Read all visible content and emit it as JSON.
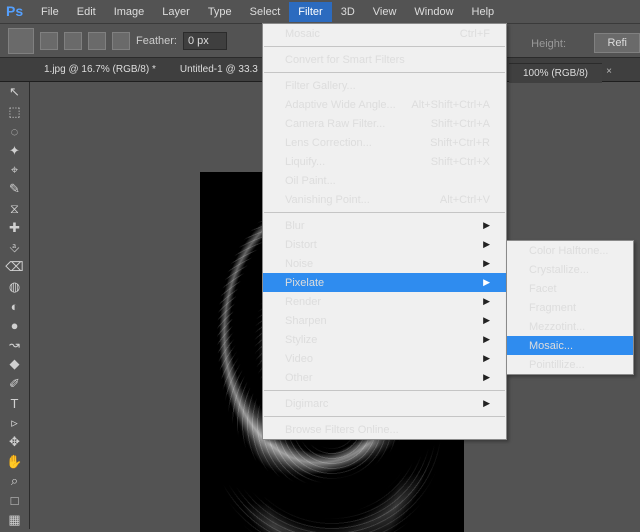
{
  "logo": "Ps",
  "menu": {
    "items": [
      "File",
      "Edit",
      "Image",
      "Layer",
      "Type",
      "Select",
      "Filter",
      "3D",
      "View",
      "Window",
      "Help"
    ],
    "open": "Filter"
  },
  "options": {
    "feather_label": "Feather:",
    "feather_value": "0 px",
    "height_label": "Height:",
    "refine_btn": "Refi"
  },
  "tabs": {
    "doc1": "1.jpg @ 16.7% (RGB/8) *",
    "doc2": "Untitled-1 @ 33.3",
    "zoombox": "100% (RGB/8)"
  },
  "zoom_x": "×",
  "filter_menu": {
    "last": {
      "label": "Mosaic",
      "shortcut": "Ctrl+F"
    },
    "convert_smart": "Convert for Smart Filters",
    "gallery": "Filter Gallery...",
    "adaptive": {
      "label": "Adaptive Wide Angle...",
      "shortcut": "Alt+Shift+Ctrl+A"
    },
    "raw": {
      "label": "Camera Raw Filter...",
      "shortcut": "Shift+Ctrl+A"
    },
    "lens": {
      "label": "Lens Correction...",
      "shortcut": "Shift+Ctrl+R"
    },
    "liquify": {
      "label": "Liquify...",
      "shortcut": "Shift+Ctrl+X"
    },
    "oil": "Oil Paint...",
    "vanish": {
      "label": "Vanishing Point...",
      "shortcut": "Alt+Ctrl+V"
    },
    "groups": [
      "Blur",
      "Distort",
      "Noise",
      "Pixelate",
      "Render",
      "Sharpen",
      "Stylize",
      "Video",
      "Other"
    ],
    "digimarc": "Digimarc",
    "browse": "Browse Filters Online...",
    "highlight": "Pixelate"
  },
  "pixelate_sub": {
    "items": [
      "Color Halftone...",
      "Crystallize...",
      "Facet",
      "Fragment",
      "Mezzotint...",
      "Mosaic...",
      "Pointillize..."
    ],
    "highlight": "Mosaic..."
  },
  "tools": [
    "↖",
    "⬚",
    "◌",
    "✦",
    "⌖",
    "✎",
    "⧖",
    "✚",
    "⎀",
    "⌫",
    "◍",
    "◐",
    "●",
    "↝",
    "◆",
    "✐",
    "T",
    "▹",
    "✥",
    "✋",
    "⌕",
    "□",
    "▦"
  ]
}
